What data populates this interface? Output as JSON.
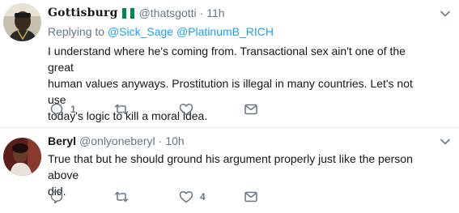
{
  "tweets": [
    {
      "name": "Gottisburg",
      "flag_colors": [
        "#008751",
        "#ffffff",
        "#008751"
      ],
      "handle": "@thatsgotti",
      "separator": "·",
      "time": "11h",
      "reply_prefix": "Replying to",
      "reply_to": [
        "@Sick_Sage",
        "@PlatinumB_RICH"
      ],
      "text_lines": [
        "I understand where he's coming from. Transactional sex ain't one of the great",
        "human values anyways. Prostitution is illegal in many countries. Let's not use",
        "today's  logic to kill a moral idea."
      ],
      "reply_count": "1",
      "retweet_count": "",
      "like_count": ""
    },
    {
      "name": "Beryl",
      "handle": "@onlyoneberyl",
      "separator": "·",
      "time": "10h",
      "text_lines": [
        "True that but he should ground his argument properly just like the person above",
        "did."
      ],
      "reply_count": "",
      "retweet_count": "",
      "like_count": "4"
    }
  ],
  "icons": {
    "more": "chevron-down-icon",
    "reply": "reply-icon",
    "retweet": "retweet-icon",
    "like": "heart-icon",
    "dm": "envelope-icon"
  },
  "colors": {
    "link": "#1da1f2",
    "secondary_text": "#657786",
    "primary_text": "#14171a",
    "divider": "#e6ecf0"
  }
}
